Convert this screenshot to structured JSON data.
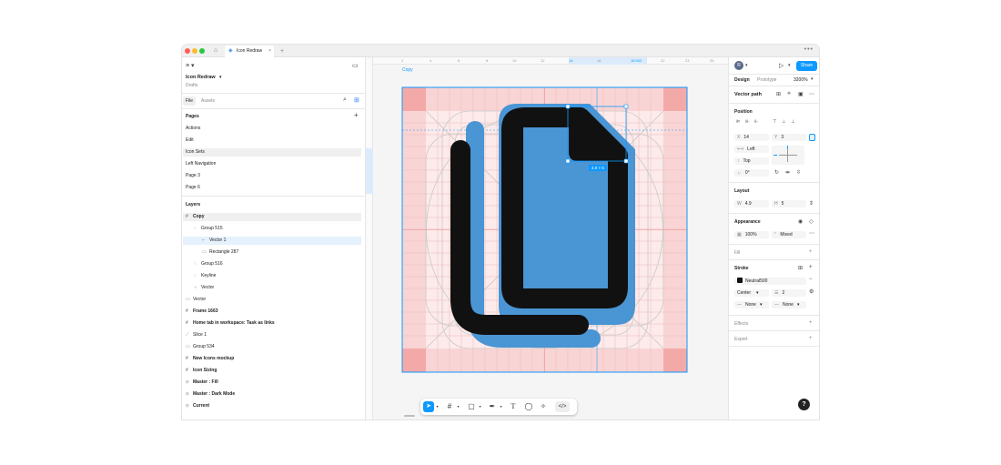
{
  "app": {
    "tab_title": "Icon Redraw",
    "file_name": "Icon Redraw",
    "location": "Drafts",
    "tab_close": "×",
    "new_tab": "+",
    "more": "•••"
  },
  "left_panel": {
    "tabs": [
      "File",
      "Assets"
    ],
    "pages_title": "Pages",
    "pages": [
      "Actions",
      "Edit",
      "Icon Sets",
      "Left Navigation",
      "Page 3",
      "Page 6"
    ],
    "layers_title": "Layers",
    "layers": [
      {
        "label": "Copy",
        "icon": "#",
        "bold": true
      },
      {
        "label": "Group 515",
        "icon": "◌"
      },
      {
        "label": "Vector 1",
        "icon": "⌐"
      },
      {
        "label": "Rectangle 287",
        "icon": "▭"
      },
      {
        "label": "Group 516",
        "icon": "◌"
      },
      {
        "label": "Keyline",
        "icon": "◌"
      },
      {
        "label": "Vector",
        "icon": "♁"
      },
      {
        "label": "Vector",
        "icon": "▭"
      },
      {
        "label": "Frame 1663",
        "icon": "#",
        "bold": true
      },
      {
        "label": "Home tab in workspace: Task as links",
        "icon": "#",
        "bold": true
      },
      {
        "label": "Slice 1",
        "icon": "⟋"
      },
      {
        "label": "Group 534",
        "icon": "▭"
      },
      {
        "label": "New Icons mockup",
        "icon": "#",
        "bold": true
      },
      {
        "label": "Icon Sizing",
        "icon": "#",
        "bold": true
      },
      {
        "label": "Master : Fill",
        "icon": "⬦",
        "bold": true
      },
      {
        "label": "Master : Dark Mode",
        "icon": "⬦",
        "bold": true
      },
      {
        "label": "Current",
        "icon": "⬦",
        "bold": true
      }
    ]
  },
  "ruler": {
    "top_ticks": [
      "2",
      "4",
      "6",
      "8",
      "10",
      "12",
      "14",
      "16",
      "18.902",
      "22",
      "23",
      "26"
    ],
    "left_ticks": [
      "2",
      "4",
      "6",
      "8",
      "10",
      "12",
      "14",
      "16",
      "18",
      "20",
      "22",
      "24"
    ]
  },
  "canvas": {
    "frame_label": "Copy",
    "selection_size": "4.9 × 5"
  },
  "right_panel": {
    "avatar_initial": "R",
    "share_label": "Share",
    "tabs": [
      "Design",
      "Prototype"
    ],
    "zoom": "3200%",
    "selection_type": "Vector path",
    "position_title": "Position",
    "x_label": "X",
    "x_value": "14",
    "y_label": "Y",
    "y_value": "3",
    "constraint_h": "Left",
    "constraint_v": "Top",
    "rotation": "0°",
    "layout_title": "Layout",
    "w_label": "W",
    "w_value": "4.9",
    "h_label": "H",
    "h_value": "5",
    "appearance_title": "Appearance",
    "opacity": "100%",
    "radius": "Mixed",
    "fill_title": "Fill",
    "stroke_title": "Stroke",
    "stroke_color_name": "Neutral500",
    "stroke_position": "Center",
    "stroke_weight": "2",
    "stroke_start": "None",
    "stroke_end": "None",
    "effects_title": "Effects",
    "export_title": "Export"
  },
  "toolbar": {
    "tools": [
      "move-tool",
      "frame-tool",
      "shape-tool",
      "pen-tool",
      "text-tool",
      "comment-tool",
      "actions-tool",
      "dev-mode-toggle"
    ]
  },
  "help_label": "?",
  "colors": {
    "accent": "#0d99ff",
    "icon_black": "#111111",
    "icon_blue": "#4a95d4",
    "keyline_pink": "#f9d4d4",
    "corner_pink": "#f4a9a9"
  }
}
